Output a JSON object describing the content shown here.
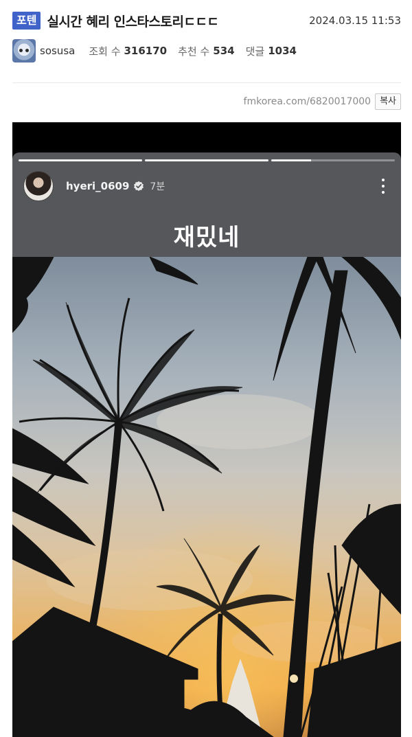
{
  "post": {
    "category": "포텐",
    "title": "실시간 혜리 인스타스토리ㄷㄷㄷ",
    "date": "2024.03.15 11:53",
    "author": "sosusa",
    "views_label": "조회 수",
    "views": "316170",
    "recommend_label": "추천 수",
    "recommends": "534",
    "comments_label": "댓글",
    "comments": "1034",
    "url": "fmkorea.com/6820017000",
    "copy_label": "복사"
  },
  "story": {
    "username": "hyeri_0609",
    "time": "7분",
    "caption": "재밌네",
    "progress": [
      1.0,
      1.0,
      0.32
    ],
    "icons": [
      "verified-icon",
      "more-icon"
    ]
  },
  "colors": {
    "badge": "#3f63c9",
    "story_panel": "#56575b"
  }
}
